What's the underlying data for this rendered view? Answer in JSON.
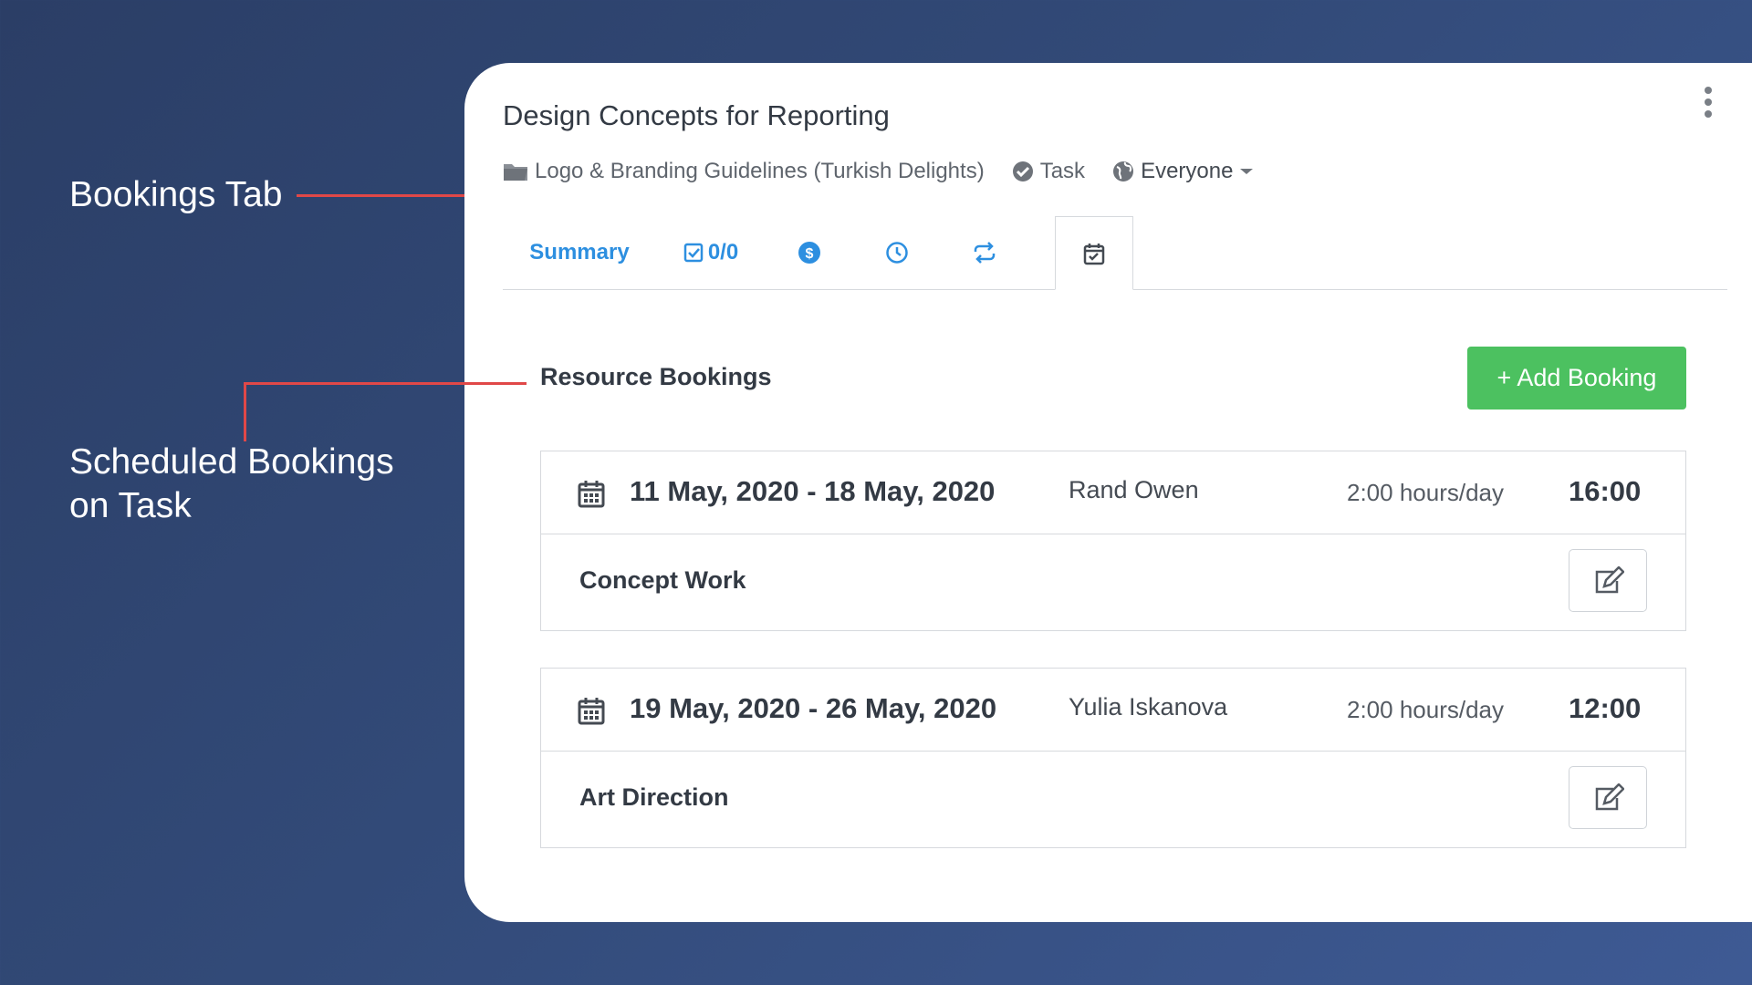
{
  "callouts": {
    "bookings_tab": "Bookings Tab",
    "scheduled_line1": "Scheduled Bookings",
    "scheduled_line2": "on Task"
  },
  "task": {
    "title": "Design Concepts for Reporting",
    "project": "Logo & Branding Guidelines (Turkish Delights)",
    "type": "Task",
    "visibility": "Everyone"
  },
  "tabs": {
    "summary": "Summary",
    "checklist": "0/0"
  },
  "section": {
    "title": "Resource Bookings",
    "add_button": "+ Add Booking"
  },
  "bookings": [
    {
      "range": "11 May, 2020 - 18 May, 2020",
      "person": "Rand Owen",
      "rate": "2:00 hours/day",
      "total": "16:00",
      "name": "Concept Work"
    },
    {
      "range": "19 May, 2020 - 26 May, 2020",
      "person": "Yulia Iskanova",
      "rate": "2:00 hours/day",
      "total": "12:00",
      "name": "Art Direction"
    }
  ],
  "colors": {
    "accent_blue": "#2d8fe0",
    "add_green": "#4cc160",
    "callout_red": "#e04848"
  }
}
